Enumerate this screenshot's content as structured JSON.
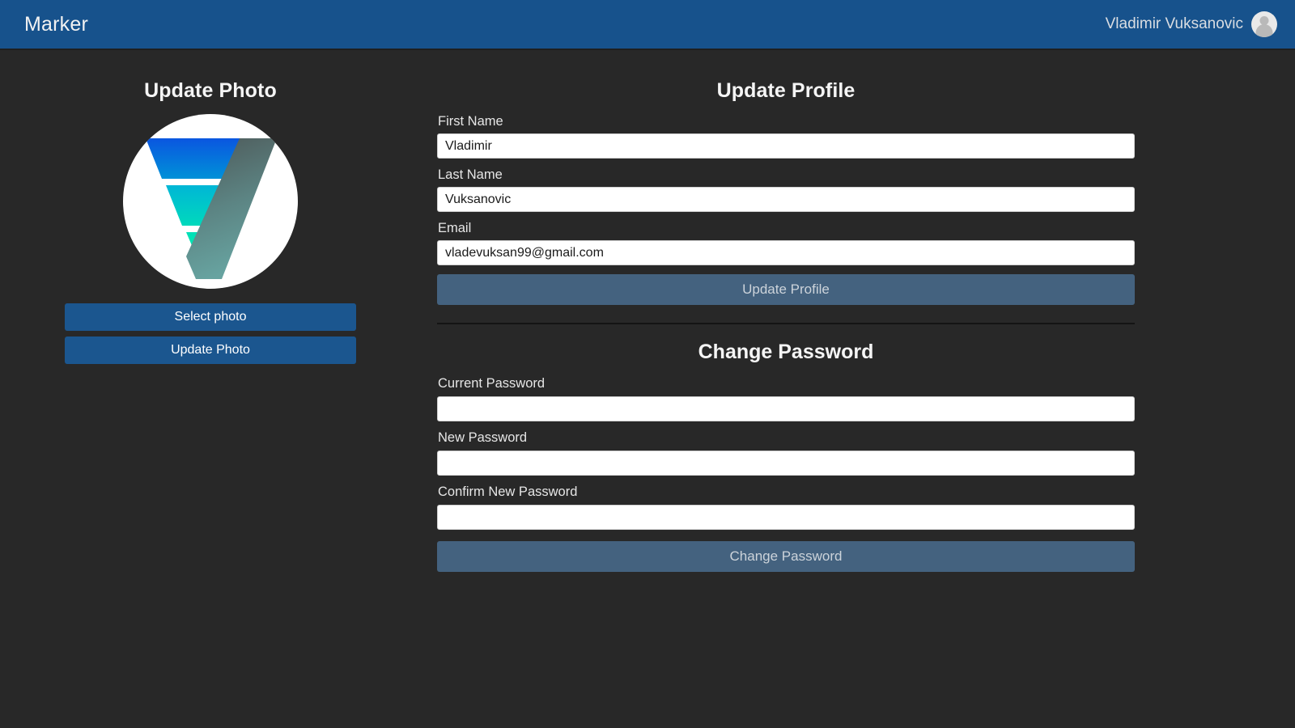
{
  "navbar": {
    "brand": "Marker",
    "user_name": "Vladimir Vuksanovic",
    "avatar_icon": "user-avatar-icon",
    "background_color": "#17528c"
  },
  "photo_panel": {
    "title": "Update Photo",
    "logo_icon": "marker-funnel-logo",
    "select_photo_label": "Select photo",
    "update_photo_label": "Update Photo"
  },
  "profile_panel": {
    "title": "Update Profile",
    "fields": [
      {
        "label": "First Name",
        "value": "Vladimir",
        "placeholder": ""
      },
      {
        "label": "Last Name",
        "value": "Vuksanovic",
        "placeholder": ""
      },
      {
        "label": "Email",
        "value": "vladevuksan99@gmail.com",
        "placeholder": ""
      }
    ],
    "submit_label": "Update Profile"
  },
  "password_panel": {
    "title": "Change Password",
    "fields": [
      {
        "label": "Current Password",
        "value": "",
        "placeholder": ""
      },
      {
        "label": "New Password",
        "value": "",
        "placeholder": ""
      },
      {
        "label": "Confirm New Password",
        "value": "",
        "placeholder": ""
      }
    ],
    "submit_label": "Change Password"
  },
  "colors": {
    "page_background": "#282828",
    "navbar": "#17528c",
    "button_primary": "#1b568f",
    "button_muted": "#44627f",
    "logo_top": "#0a5fd8",
    "logo_mid": "#00c4d4",
    "logo_bottom": "#00f0b0",
    "logo_slash_top": "#555e5e",
    "logo_slash_bottom": "#5f9a9a"
  }
}
